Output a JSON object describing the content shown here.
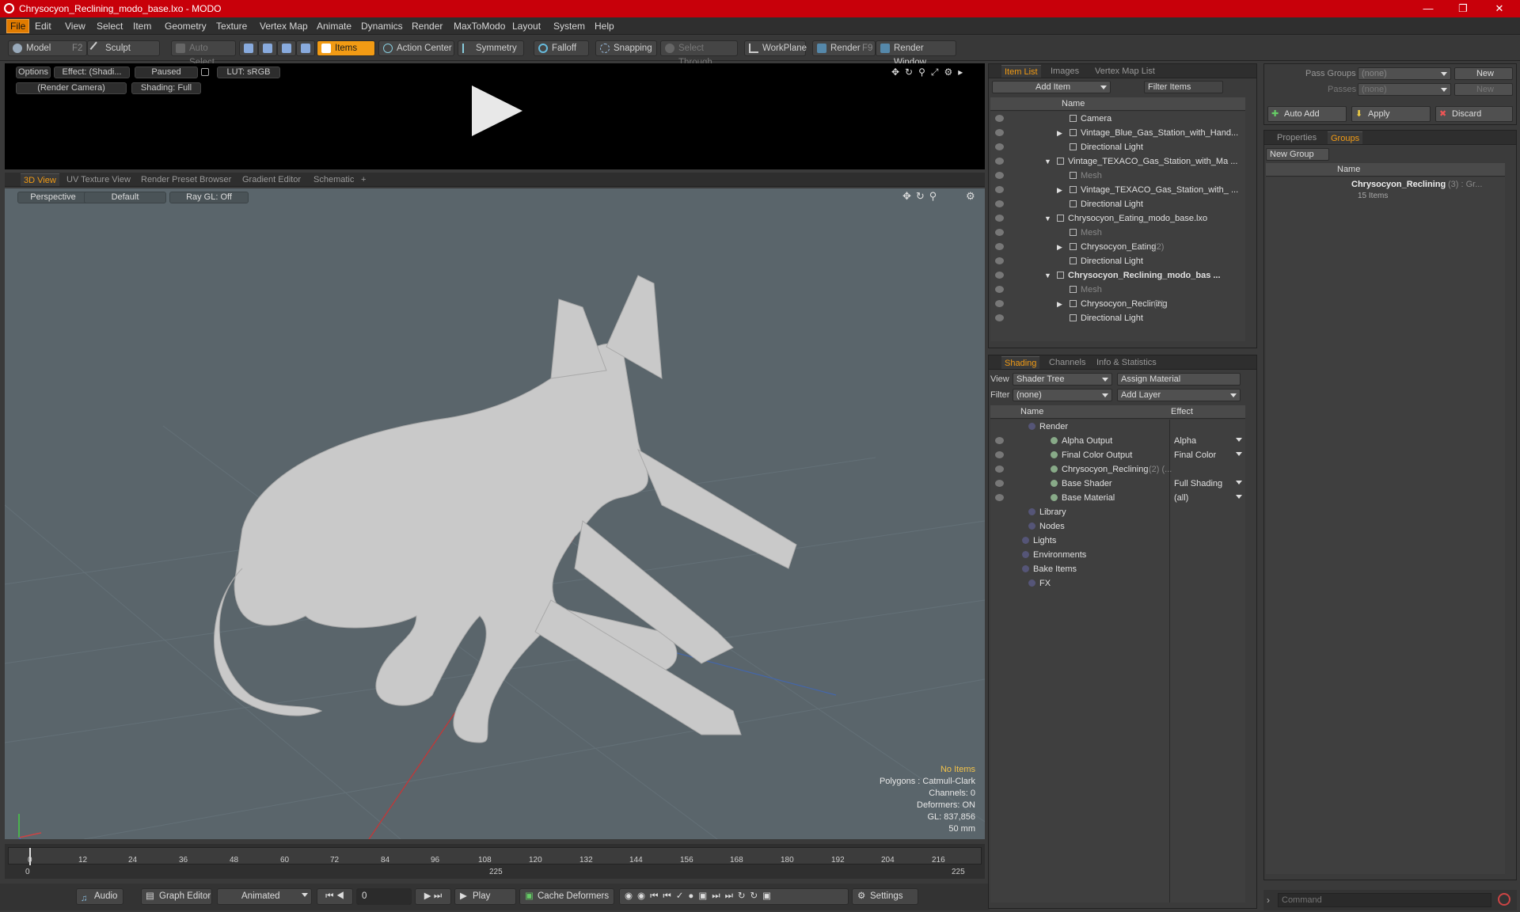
{
  "window": {
    "title": "Chrysocyon_Reclining_modo_base.lxo - MODO"
  },
  "menu": [
    "File",
    "Edit",
    "View",
    "Select",
    "Item",
    "Geometry",
    "Texture",
    "Vertex Map",
    "Animate",
    "Dynamics",
    "Render",
    "MaxToModo",
    "Layout",
    "System",
    "Help"
  ],
  "toolbar": {
    "model": "Model",
    "model_key": "F2",
    "sculpt": "Sculpt",
    "auto_select": "Auto Select",
    "items": "Items",
    "action_center": "Action Center",
    "symmetry": "Symmetry",
    "falloff": "Falloff",
    "snapping": "Snapping",
    "select_through": "Select Through",
    "workplane": "WorkPlane",
    "render": "Render",
    "render_key": "F9",
    "render_window": "Render Window"
  },
  "render_preview": {
    "options": "Options",
    "effect": "Effect: (Shadi...",
    "paused": "Paused",
    "lut": "LUT: sRGB",
    "camera": "(Render Camera)",
    "shading": "Shading: Full"
  },
  "view_tabs": [
    "3D View",
    "UV Texture View",
    "Render Preset Browser",
    "Gradient Editor",
    "Schematic"
  ],
  "viewport": {
    "perspective": "Perspective",
    "default": "Default",
    "raygl": "Ray GL: Off",
    "info": [
      "No Items",
      "Polygons : Catmull-Clark",
      "Channels: 0",
      "Deformers: ON",
      "GL: 837,856",
      "50 mm"
    ]
  },
  "timeline": {
    "ticks": [
      "0",
      "12",
      "24",
      "36",
      "48",
      "60",
      "72",
      "84",
      "96",
      "108",
      "120",
      "132",
      "144",
      "156",
      "168",
      "180",
      "192",
      "204",
      "216"
    ],
    "start": "0",
    "mid": "225",
    "end": "225"
  },
  "transport": {
    "audio": "Audio",
    "graph_editor": "Graph Editor",
    "animated": "Animated",
    "frame": "0",
    "play": "Play",
    "cache": "Cache Deformers",
    "settings": "Settings"
  },
  "item_list": {
    "tabs": [
      "Item List",
      "Images",
      "Vertex Map List"
    ],
    "add_item": "Add Item",
    "filter": "Filter Items",
    "col_name": "Name",
    "rows": [
      {
        "label": "Camera",
        "indent": 2,
        "style": ""
      },
      {
        "label": "Vintage_Blue_Gas_Station_with_Hand...",
        "indent": 2,
        "style": "",
        "arrow": true
      },
      {
        "label": "Directional Light",
        "indent": 2,
        "style": ""
      },
      {
        "label": "Vintage_TEXACO_Gas_Station_with_Ma ...",
        "indent": 1,
        "style": "",
        "open": true
      },
      {
        "label": "Mesh",
        "indent": 2,
        "style": "gray"
      },
      {
        "label": "Vintage_TEXACO_Gas_Station_with_ ...",
        "indent": 2,
        "style": "",
        "arrow": true
      },
      {
        "label": "Directional Light",
        "indent": 2,
        "style": ""
      },
      {
        "label": "Chrysocyon_Eating_modo_base.lxo",
        "indent": 1,
        "style": "",
        "open": true
      },
      {
        "label": "Mesh",
        "indent": 2,
        "style": "gray"
      },
      {
        "label": "Chrysocyon_Eating",
        "count": "(2)",
        "indent": 2,
        "style": "",
        "arrow": true
      },
      {
        "label": "Directional Light",
        "indent": 2,
        "style": ""
      },
      {
        "label": "Chrysocyon_Reclining_modo_bas ...",
        "indent": 1,
        "style": "bold",
        "open": true
      },
      {
        "label": "Mesh",
        "indent": 2,
        "style": "gray"
      },
      {
        "label": "Chrysocyon_Reclining",
        "count": "(2)",
        "indent": 2,
        "style": "",
        "arrow": true
      },
      {
        "label": "Directional Light",
        "indent": 2,
        "style": ""
      }
    ]
  },
  "shading": {
    "tabs": [
      "Shading",
      "Channels",
      "Info & Statistics"
    ],
    "view_label": "View",
    "view_value": "Shader Tree",
    "assign": "Assign Material",
    "filter_label": "Filter",
    "filter_value": "(none)",
    "add_layer": "Add Layer",
    "col_name": "Name",
    "col_effect": "Effect",
    "rows": [
      {
        "label": "Render",
        "effect": "",
        "indent": 0
      },
      {
        "label": "Alpha Output",
        "effect": "Alpha",
        "indent": 1
      },
      {
        "label": "Final Color Output",
        "effect": "Final Color",
        "indent": 1
      },
      {
        "label": "Chrysocyon_Reclining",
        "count": "(2) (...",
        "effect": "",
        "indent": 1
      },
      {
        "label": "Base Shader",
        "effect": "Full Shading",
        "indent": 1
      },
      {
        "label": "Base Material",
        "effect": "(all)",
        "indent": 1
      },
      {
        "label": "Library",
        "effect": "",
        "indent": 0
      },
      {
        "label": "Nodes",
        "effect": "",
        "indent": 0
      },
      {
        "label": "Lights",
        "effect": "",
        "indent": -1
      },
      {
        "label": "Environments",
        "effect": "",
        "indent": -1
      },
      {
        "label": "Bake Items",
        "effect": "",
        "indent": -1
      },
      {
        "label": "FX",
        "effect": "",
        "indent": 0
      }
    ]
  },
  "pass": {
    "pass_groups": "Pass Groups",
    "passes": "Passes",
    "none": "(none)",
    "new": "New",
    "auto_add": "Auto Add",
    "apply": "Apply",
    "discard": "Discard"
  },
  "groups": {
    "tabs": [
      "Properties",
      "Groups"
    ],
    "new_group": "New Group",
    "col_name": "Name",
    "group_name": "Chrysocyon_Reclining",
    "group_count": "(3) : Gr...",
    "group_items": "15 Items"
  },
  "command": {
    "placeholder": "Command"
  }
}
